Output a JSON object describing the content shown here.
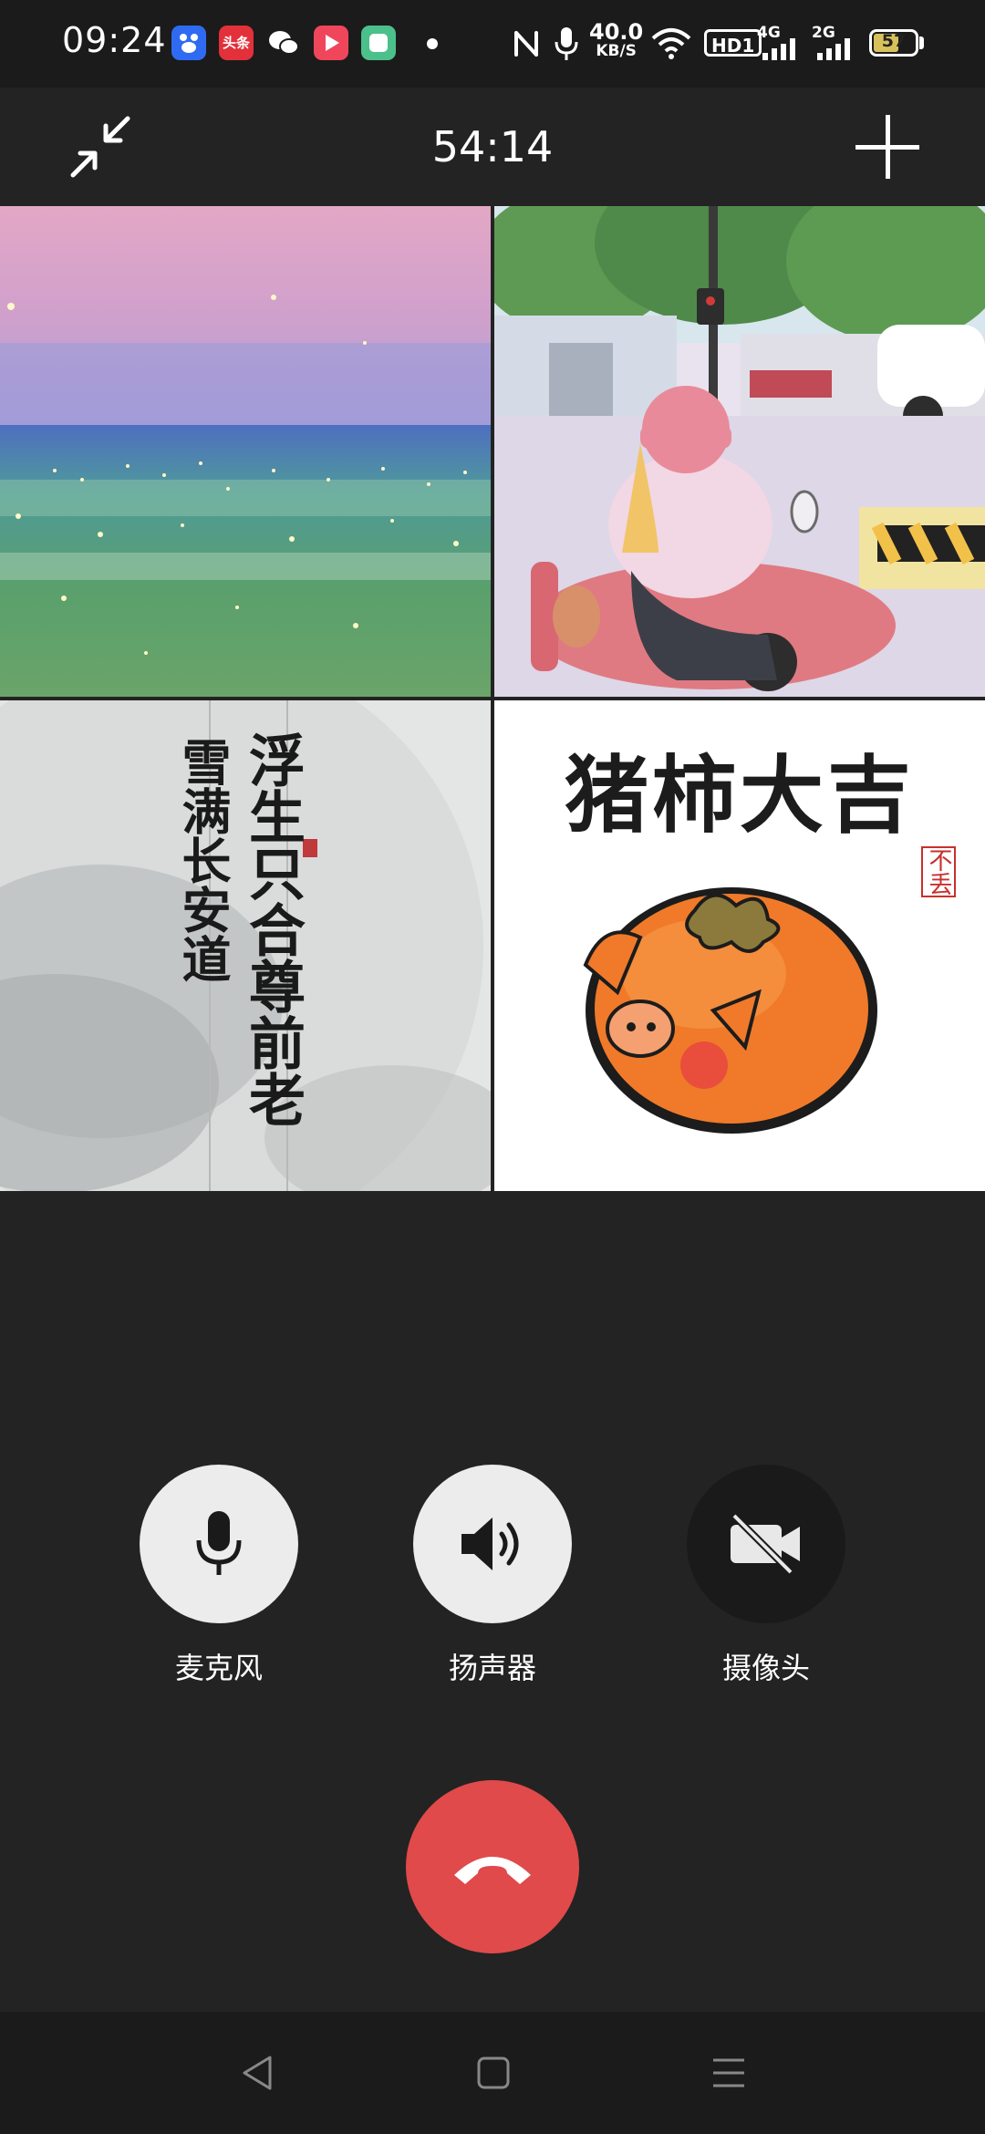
{
  "status_bar": {
    "time": "09:24",
    "apps": [
      {
        "icon": "baidu-app-icon",
        "color": "#3a6ff0"
      },
      {
        "icon": "toutiao-app-icon",
        "color": "#e2313a",
        "text": "头条"
      },
      {
        "icon": "wechat-app-icon",
        "color": "#ffffff"
      },
      {
        "icon": "video-app-icon",
        "color": "#f0465c"
      },
      {
        "icon": "green-app-icon",
        "color": "#4cc08a"
      }
    ],
    "network_speed": "40.0",
    "network_speed_unit": "KB/S",
    "hd_badge": "HD1",
    "net1": "4G",
    "net2": "2G",
    "battery_level": "57"
  },
  "header": {
    "timer": "54:14"
  },
  "participants": [
    {
      "name": "tile-sea-painting",
      "scene": "sea"
    },
    {
      "name": "tile-girl-scooter",
      "scene": "street"
    },
    {
      "name": "tile-calligraphy",
      "scene": "calligraphy",
      "text_right": "浮生只合尊前老",
      "text_left": "雪满长安道"
    },
    {
      "name": "tile-pig-persimmon",
      "scene": "pig",
      "title": "猪柿大吉",
      "seal": "不丢"
    }
  ],
  "controls": {
    "mic_label": "麦克风",
    "speaker_label": "扬声器",
    "camera_label": "摄像头"
  },
  "colors": {
    "background": "#232323",
    "hangup": "#e04a4a",
    "control_active": "#ececec",
    "control_inactive": "#1a1a1a"
  }
}
